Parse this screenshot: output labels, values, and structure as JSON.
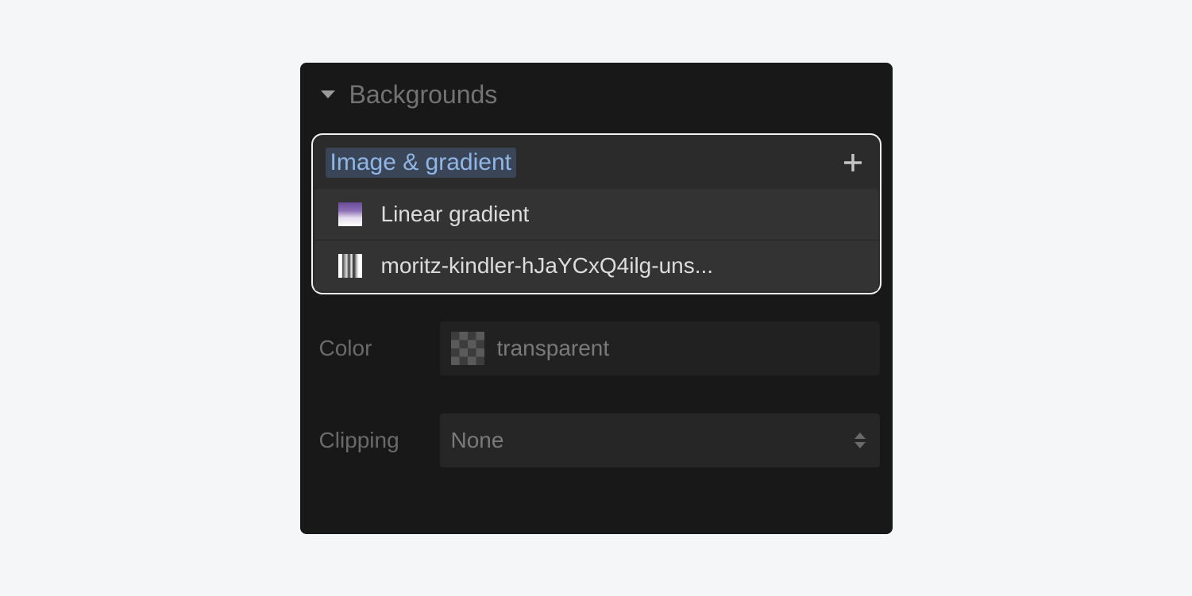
{
  "section": {
    "title": "Backgrounds"
  },
  "subsection": {
    "title": "Image & gradient"
  },
  "layers": [
    {
      "label": "Linear gradient"
    },
    {
      "label": "moritz-kindler-hJaYCxQ4ilg-uns..."
    }
  ],
  "color": {
    "label": "Color",
    "value": "transparent"
  },
  "clipping": {
    "label": "Clipping",
    "value": "None"
  }
}
